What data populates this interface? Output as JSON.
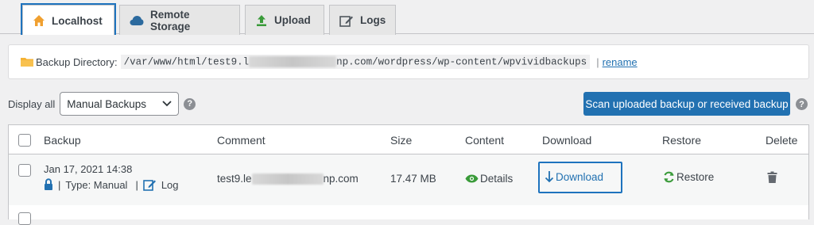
{
  "tabs": [
    {
      "label": "Localhost",
      "icon": "home-icon",
      "active": true
    },
    {
      "label": "Remote Storage",
      "icon": "cloud-icon",
      "active": false
    },
    {
      "label": "Upload",
      "icon": "upload-icon",
      "active": false
    },
    {
      "label": "Logs",
      "icon": "edit-icon",
      "active": false
    }
  ],
  "backup_dir": {
    "label": "Backup Directory:",
    "path_start": "/var/www/html/test9.l",
    "path_end": "np.com/wordpress/wp-content/wpvividbackups",
    "separator": "|",
    "rename": "rename"
  },
  "display": {
    "label": "Display all",
    "selected": "Manual Backups"
  },
  "scan_button": "Scan uploaded backup or received backup",
  "table": {
    "headers": {
      "backup": "Backup",
      "comment": "Comment",
      "size": "Size",
      "content": "Content",
      "download": "Download",
      "restore": "Restore",
      "delete": "Delete"
    },
    "rows": [
      {
        "date": "Jan 17, 2021 14:38",
        "separator": "|",
        "type": "Type: Manual",
        "separator2": "|",
        "log": "Log",
        "comment_start": "test9.le",
        "comment_end": "np.com",
        "size": "17.47 MB",
        "details": "Details",
        "download": "Download",
        "restore": "Restore"
      }
    ]
  },
  "colors": {
    "accent": "#2271b1",
    "highlight": "#1e73be",
    "home_icon": "#f0a030",
    "green": "#3a9b3a"
  }
}
